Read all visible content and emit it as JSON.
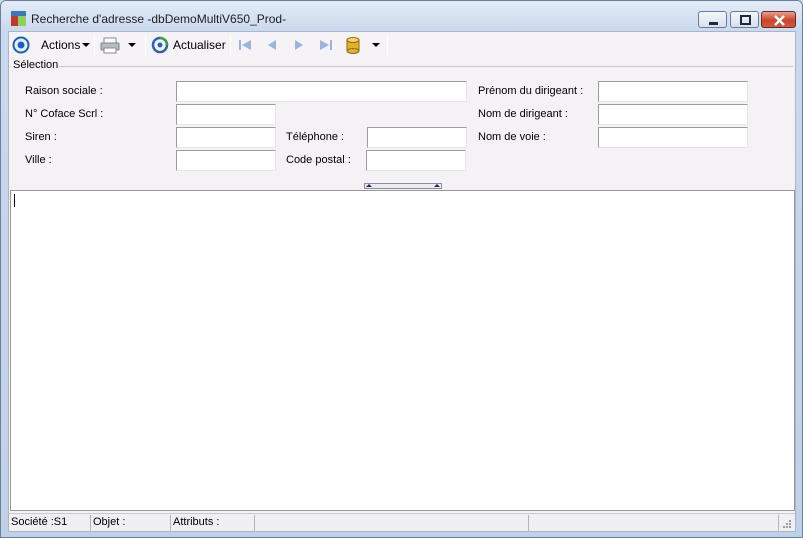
{
  "window": {
    "title": "Recherche d'adresse -dbDemoMultiV650_Prod-"
  },
  "toolbar": {
    "actions_label": "Actions",
    "refresh_label": "Actualiser"
  },
  "selection": {
    "group_label": "Sélection",
    "fields": {
      "raison_sociale": {
        "label": "Raison sociale :",
        "value": ""
      },
      "n_coface": {
        "label": "N° Coface Scrl :",
        "value": ""
      },
      "siren": {
        "label": "Siren :",
        "value": ""
      },
      "ville": {
        "label": "Ville :",
        "value": ""
      },
      "telephone": {
        "label": "Téléphone :",
        "value": ""
      },
      "code_postal": {
        "label": "Code postal :",
        "value": ""
      },
      "prenom_dirigeant": {
        "label": "Prénom du dirigeant :",
        "value": ""
      },
      "nom_dirigeant": {
        "label": "Nom de dirigeant :",
        "value": ""
      },
      "nom_voie": {
        "label": "Nom de voie :",
        "value": ""
      }
    }
  },
  "status": {
    "societe": "Société :S1",
    "objet": "Objet :",
    "attributs": "Attributs :"
  },
  "icons": {
    "app": "app-window-icon",
    "target": "target-icon",
    "print": "printer-icon",
    "refresh": "refresh-icon",
    "first": "first-record-icon",
    "prev": "previous-record-icon",
    "next": "next-record-icon",
    "last": "last-record-icon",
    "database": "database-icon"
  }
}
